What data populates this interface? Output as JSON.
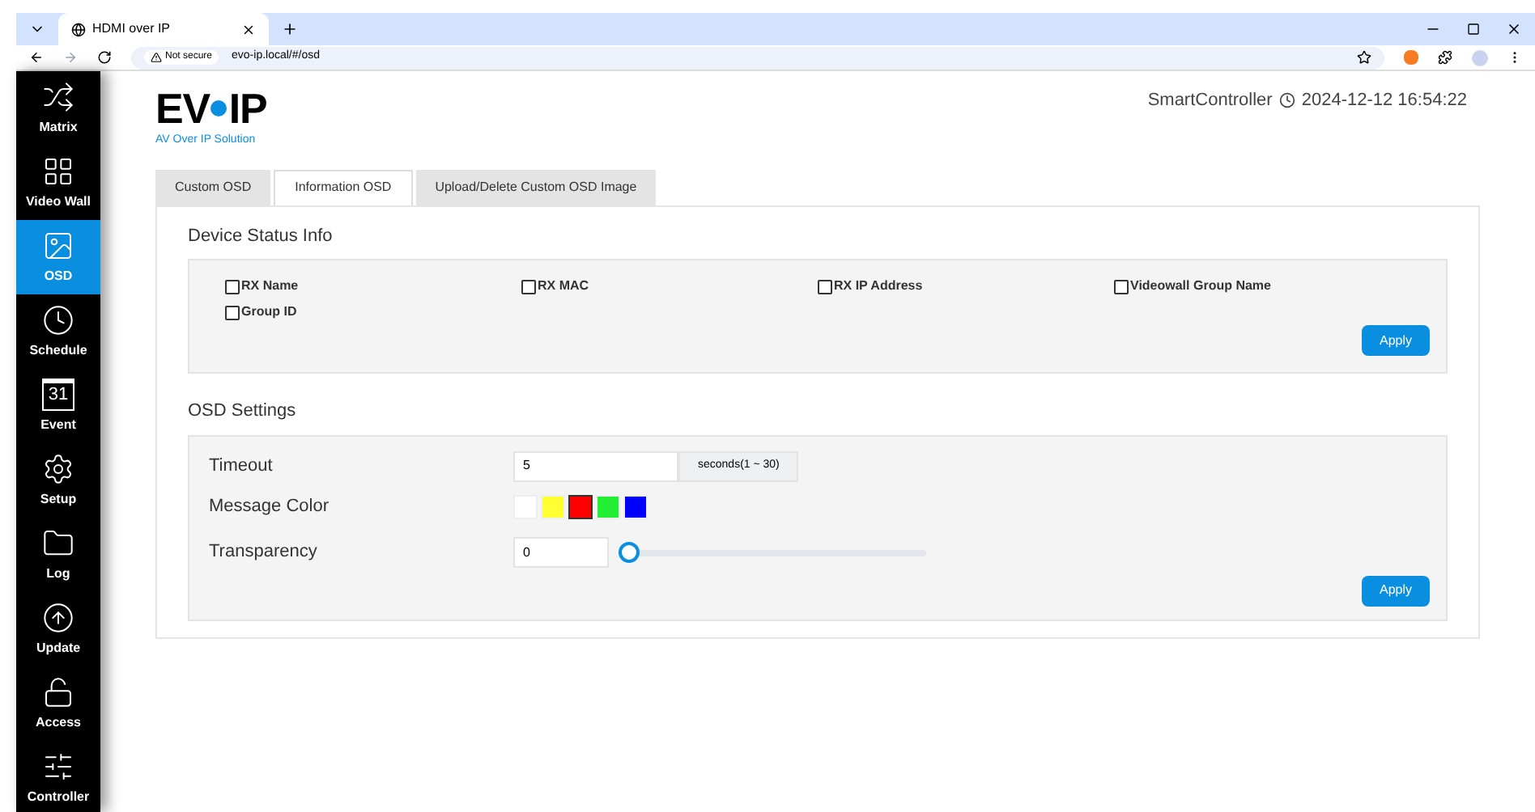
{
  "browser": {
    "tab_title": "HDMI over IP",
    "security": "Not secure",
    "url": "evo-ip.local/#/osd"
  },
  "sidebar": {
    "items": [
      {
        "label": "Matrix",
        "kind": "matrix",
        "selected": false
      },
      {
        "label": "Video Wall",
        "kind": "grid",
        "selected": false
      },
      {
        "label": "OSD",
        "kind": "image",
        "selected": true
      },
      {
        "label": "Schedule",
        "kind": "clock",
        "selected": false
      },
      {
        "label": "Event",
        "kind": "calendar",
        "badge": "31",
        "selected": false
      },
      {
        "label": "Setup",
        "kind": "gear",
        "selected": false
      },
      {
        "label": "Log",
        "kind": "folder",
        "selected": false
      },
      {
        "label": "Update",
        "kind": "upload",
        "selected": false
      },
      {
        "label": "Access",
        "kind": "lock",
        "selected": false
      },
      {
        "label": "Controller",
        "kind": "sliders",
        "selected": false
      }
    ]
  },
  "header": {
    "logo": "EV",
    "logo_end": "IP",
    "tagline": "AV Over IP Solution",
    "controller": "SmartController",
    "datetime": "2024-12-12 16:54:22"
  },
  "tabs": [
    {
      "label": "Custom OSD",
      "selected": false
    },
    {
      "label": "Information OSD",
      "selected": true
    },
    {
      "label": "Upload/Delete Custom OSD Image",
      "selected": false
    }
  ],
  "device_status": {
    "title": "Device Status Info",
    "options": [
      {
        "label": "RX Name",
        "checked": false
      },
      {
        "label": "RX MAC",
        "checked": false
      },
      {
        "label": "RX IP Address",
        "checked": false
      },
      {
        "label": "Videowall Group Name",
        "checked": false
      },
      {
        "label": "Group ID",
        "checked": false
      }
    ],
    "button": "Apply"
  },
  "osd_settings": {
    "title": "OSD Settings",
    "timeout": {
      "label": "Timeout",
      "value": "5",
      "unit": "seconds(1 ~ 30)"
    },
    "message_color": {
      "label": "Message Color",
      "colors": [
        {
          "color": "#ffffff",
          "selected": false
        },
        {
          "color": "#ffff33",
          "selected": false
        },
        {
          "color": "#ff0000",
          "selected": true
        },
        {
          "color": "#22ee33",
          "selected": false
        },
        {
          "color": "#0000ff",
          "selected": false
        }
      ]
    },
    "transparency": {
      "label": "Transparency",
      "value": "0",
      "level": 0
    },
    "button": "Apply"
  }
}
